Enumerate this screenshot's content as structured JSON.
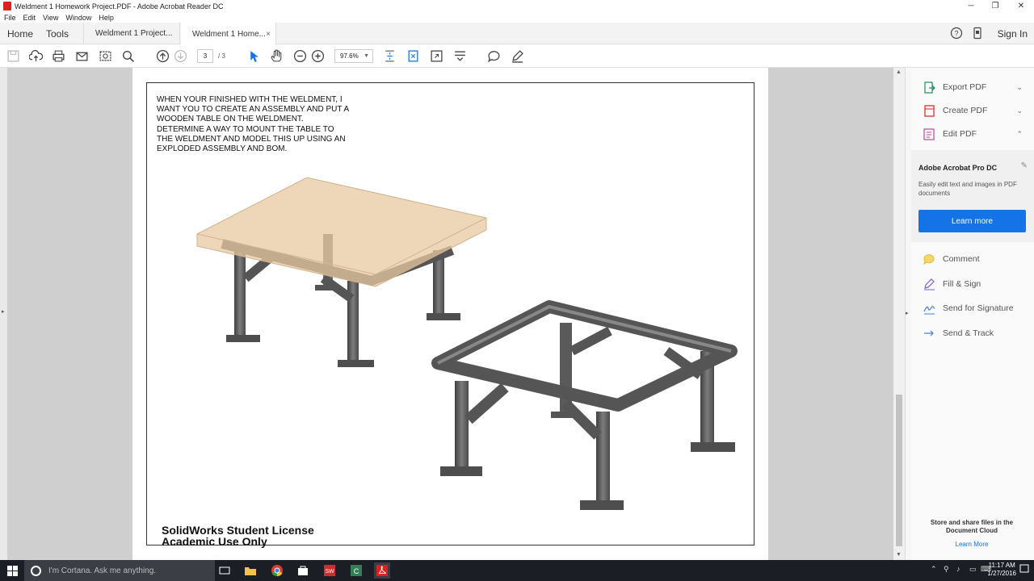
{
  "window": {
    "title": "Weldment 1 Homework Project.PDF - Adobe Acrobat Reader DC"
  },
  "menu": [
    "File",
    "Edit",
    "View",
    "Window",
    "Help"
  ],
  "tabs": {
    "home": "Home",
    "tools": "Tools",
    "doc1": "Weldment 1 Project...",
    "doc2": "Weldment 1 Home...",
    "close": "×",
    "signin": "Sign In"
  },
  "toolbar": {
    "page_current": "3",
    "page_total": "/ 3",
    "zoom": "97.6%"
  },
  "document": {
    "instructions": "WHEN YOUR FINISHED WITH THE WELDMENT, I WANT YOU TO CREATE AN ASSEMBLY AND PUT A WOODEN TABLE ON THE WELDMENT. DETERMINE A WAY TO MOUNT THE TABLE TO THE WELDMENT AND MODEL THIS UP USING AN EXPLODED ASSEMBLY AND BOM.",
    "license_line1": "SolidWorks Student License",
    "license_line2": "Academic Use Only"
  },
  "panel": {
    "export": "Export PDF",
    "create": "Create PDF",
    "edit": "Edit PDF",
    "promo_title": "Adobe Acrobat Pro DC",
    "promo_text": "Easily edit text and images in PDF documents",
    "learn_button": "Learn more",
    "comment": "Comment",
    "fill_sign": "Fill & Sign",
    "send_signature": "Send for Signature",
    "send_track": "Send & Track",
    "cloud_text": "Store and share files in the Document Cloud",
    "learn_more_link": "Learn More"
  },
  "taskbar": {
    "search": "I'm Cortana. Ask me anything.",
    "time": "11:17 AM",
    "date": "1/27/2016"
  },
  "colors": {
    "accent": "#1473e6",
    "acrobat_red": "#d9231c",
    "taskbar": "#1b1e24"
  }
}
